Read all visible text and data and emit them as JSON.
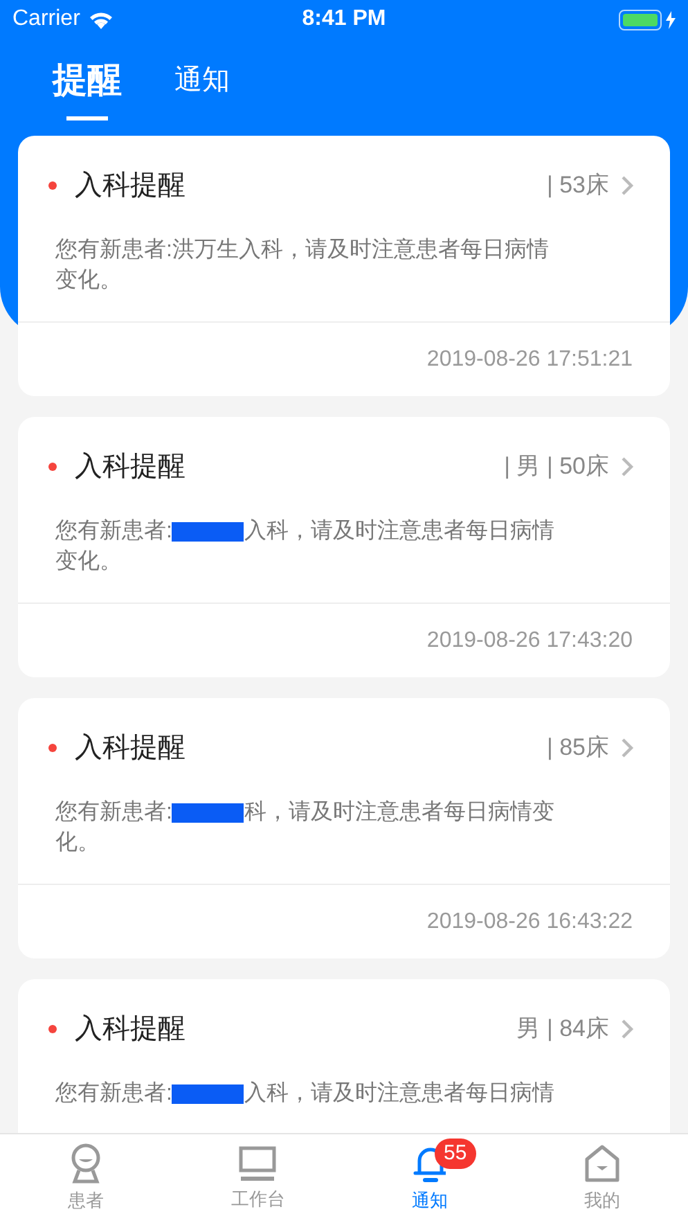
{
  "status_bar": {
    "carrier": "Carrier",
    "time": "8:41 PM"
  },
  "tabs": [
    {
      "label": "提醒",
      "selected": true
    },
    {
      "label": "通知",
      "selected": false
    }
  ],
  "cards": [
    {
      "title": "入科提醒",
      "meta": "| 53床",
      "message_before": "您有新患者:洪万生入科，请及时注意患者每日病情变化。",
      "redacted": false,
      "time": "2019-08-26 17:51:21"
    },
    {
      "title": "入科提醒",
      "meta": "| 男 | 50床",
      "message_before": "您有新患者:",
      "redacted": true,
      "message_after": "入科，请及时注意患者每日病情变化。",
      "time": "2019-08-26 17:43:20"
    },
    {
      "title": "入科提醒",
      "meta": "| 85床",
      "message_before": "您有新患者:",
      "redacted": true,
      "message_after": "科，请及时注意患者每日病情变化。",
      "time": "2019-08-26 16:43:22"
    },
    {
      "title": "入科提醒",
      "meta": "男 | 84床",
      "message_before": "您有新患者:",
      "redacted": true,
      "message_after": "入科，请及时注意患者每日病情"
    }
  ],
  "bottom_nav": [
    {
      "kind": "patient",
      "label": "患者",
      "selected": false
    },
    {
      "kind": "desk",
      "label": "工作台",
      "selected": false
    },
    {
      "kind": "bell",
      "label": "通知",
      "selected": true,
      "badge": "55"
    },
    {
      "kind": "home",
      "label": "我的",
      "selected": false
    }
  ]
}
